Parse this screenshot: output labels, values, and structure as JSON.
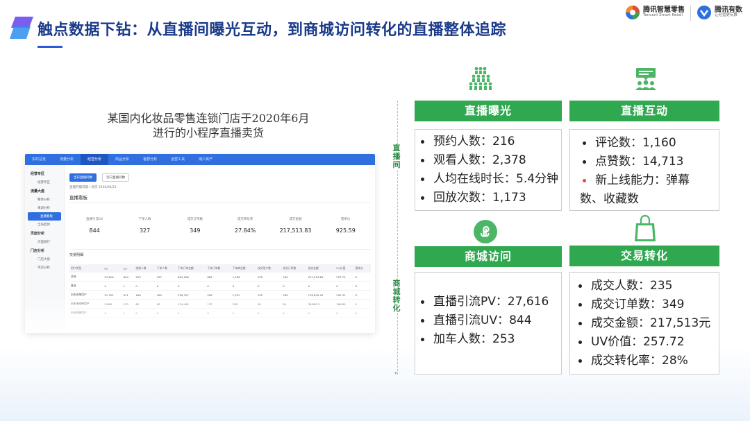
{
  "header": {
    "title": "触点数据下钻：从直播间曝光互动，到商城访问转化的直播整体追踪",
    "brand_tsr_cn": "腾讯智慧零售",
    "brand_tsr_en": "Tencent Smart Retail",
    "brand_yx_cn": "腾讯有数",
    "brand_yx_en": "让经营更有数",
    "accent_color": "#2a5bd7"
  },
  "caption": {
    "line1": "某国内化妆品零售连锁门店于2020年6月",
    "line2": "进行的小程序直播卖货"
  },
  "dashboard": {
    "tabs": [
      "实时总览",
      "流量分析",
      "经营分析",
      "商品分析",
      "客群分析",
      "运营工具",
      "用户资产"
    ],
    "sidebar": [
      {
        "group": "经营专区",
        "items": [
          "经营专区"
        ]
      },
      {
        "group": "流量大盘",
        "items": [
          "整体分析",
          "来源分析",
          "直播看板",
          "全局趋势"
        ]
      },
      {
        "group": "页面分析",
        "items": [
          "页面排行"
        ]
      },
      {
        "group": "门店分析",
        "items": [
          "门店大盘",
          "单店分析"
        ]
      }
    ],
    "filters": {
      "pill1": "当日直播间数",
      "pill2": "近日直播间数",
      "date": "直播开播日期 / 场次   2020/06/21"
    },
    "panel_title": "直播看板",
    "kpis": [
      {
        "label": "直播引流UV",
        "value": "844"
      },
      {
        "label": "下单人数",
        "value": "327"
      },
      {
        "label": "成交订单数",
        "value": "349"
      },
      {
        "label": "成交转化率",
        "value": "27.84%"
      },
      {
        "label": "成交金额",
        "value": "217,513.83"
      },
      {
        "label": "客单价",
        "value": "925.59"
      }
    ],
    "detail_title": "交易明细",
    "table": {
      "headers": [
        "用户类型",
        "PV",
        "UV",
        "加购人数",
        "下单人数",
        "下单订单金额",
        "下单订单数",
        "下单商品数",
        "成交用户数",
        "成交订单数",
        "成交金额",
        "UV价值",
        "客单价"
      ],
      "rows": [
        [
          "总体",
          "27,616",
          "844",
          "253",
          "327",
          "661,256",
          "663",
          "1,289",
          "235",
          "349",
          "217,513.83",
          "257.72",
          "0"
        ],
        [
          "直连",
          "4",
          "1",
          "0",
          "0",
          "0",
          "0",
          "0",
          "0",
          "0",
          "0",
          "0",
          "0"
        ],
        [
          "历史成单用户",
          "21,752",
          "611",
          "186",
          "265",
          "526,707",
          "526",
          "1,031",
          "195",
          "289",
          "178,630.55",
          "292.31",
          "0"
        ],
        [
          "历史未成单用户",
          "5,860",
          "233",
          "65",
          "62",
          "134,449",
          "137",
          "258",
          "40",
          "60",
          "38,883.3",
          "166.89",
          "0"
        ],
        [
          "历史成单用户",
          "4",
          "1",
          "0",
          "0",
          "0",
          "0",
          "0",
          "0",
          "0",
          "0",
          "0",
          "0"
        ]
      ]
    }
  },
  "side_labels": {
    "live": "直播间",
    "mall": "商城转化"
  },
  "cards": {
    "exposure": {
      "title": "直播曝光",
      "items": [
        "预约人数：216",
        "观看人数：2,378",
        "人均在线时长：5.4分钟",
        "回放次数：1,173"
      ]
    },
    "interaction": {
      "title": "直播互动",
      "items": [
        "评论数：1,160",
        "点赞数：14,713"
      ],
      "new_feature_1": "新上线能力：弹幕",
      "new_feature_2": "数、收藏数"
    },
    "visit": {
      "title": "商城访问",
      "items": [
        "直播引流PV：27,616",
        "直播引流UV：844",
        "加车人数：253"
      ]
    },
    "trade": {
      "title": "交易转化",
      "items": [
        "成交人数：235",
        "成交订单数：349",
        "成交金额：217,513元",
        "UV价值：257.72",
        "成交转化率：28%"
      ]
    }
  },
  "colors": {
    "card_green": "#2fa84f",
    "highlight_red": "#e24a3b",
    "icon_green": "#4bb766"
  }
}
